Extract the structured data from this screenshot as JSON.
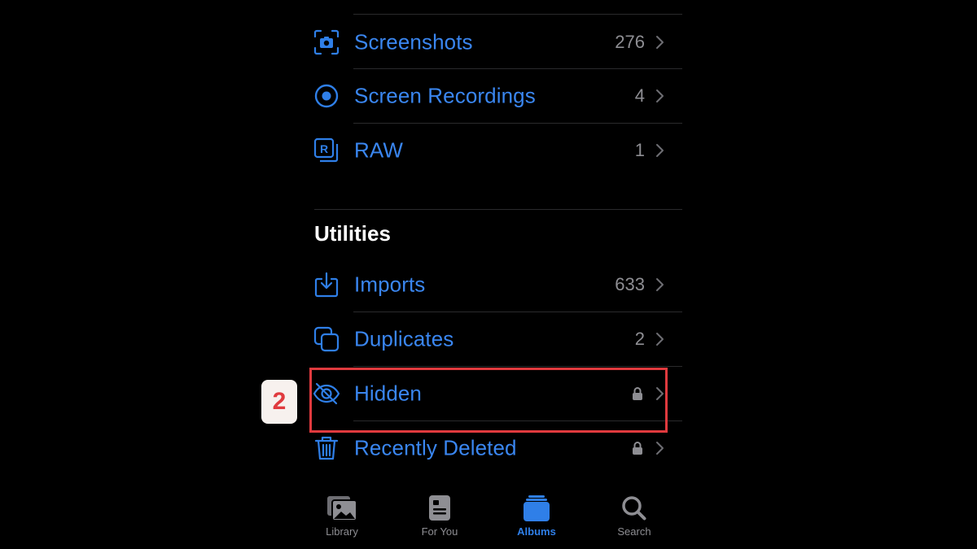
{
  "albums": {
    "items": [
      {
        "label": "Screenshots",
        "count": "276",
        "icon": "screenshot-icon"
      },
      {
        "label": "Screen Recordings",
        "count": "4",
        "icon": "record-icon"
      },
      {
        "label": "RAW",
        "count": "1",
        "icon": "raw-icon"
      }
    ]
  },
  "utilities": {
    "title": "Utilities",
    "items": [
      {
        "label": "Imports",
        "count": "633",
        "icon": "import-icon"
      },
      {
        "label": "Duplicates",
        "count": "2",
        "icon": "duplicates-icon"
      },
      {
        "label": "Hidden",
        "locked": true,
        "icon": "eye-slash-icon"
      },
      {
        "label": "Recently Deleted",
        "locked": true,
        "icon": "trash-icon"
      }
    ]
  },
  "annotation": {
    "step": "2",
    "color": "#e03a3e"
  },
  "tabbar": {
    "tabs": [
      {
        "label": "Library",
        "icon": "library-icon",
        "active": false
      },
      {
        "label": "For You",
        "icon": "for-you-icon",
        "active": false
      },
      {
        "label": "Albums",
        "icon": "albums-icon",
        "active": true
      },
      {
        "label": "Search",
        "icon": "search-icon",
        "active": false
      }
    ]
  },
  "colors": {
    "accent": "#2f7fe8",
    "background": "#000000",
    "secondary": "#8e8e93"
  }
}
